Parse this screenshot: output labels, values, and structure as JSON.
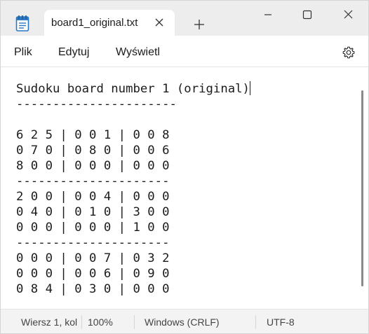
{
  "tab": {
    "title": "board1_original.txt",
    "app_icon": "notepad-icon",
    "close_icon": "close-icon",
    "new_tab_icon": "plus-icon"
  },
  "window_controls": {
    "minimize_icon": "minimize-icon",
    "maximize_icon": "maximize-icon",
    "close_icon": "close-icon"
  },
  "menu": {
    "items": [
      "Plik",
      "Edytuj",
      "Wyświetl"
    ],
    "settings_icon": "gear-icon"
  },
  "editor": {
    "lines": [
      "Sudoku board number 1 (original)",
      "----------------------",
      "",
      "6 2 5 | 0 0 1 | 0 0 8",
      "0 7 0 | 0 8 0 | 0 0 6",
      "8 0 0 | 0 0 0 | 0 0 0",
      "---------------------",
      "2 0 0 | 0 0 4 | 0 0 0",
      "0 4 0 | 0 1 0 | 3 0 0",
      "0 0 0 | 0 0 0 | 1 0 0",
      "---------------------",
      "0 0 0 | 0 0 7 | 0 3 2",
      "0 0 0 | 0 0 6 | 0 9 0",
      "0 8 4 | 0 3 0 | 0 0 0"
    ]
  },
  "status": {
    "position": "Wiersz 1, kol",
    "zoom": "100%",
    "line_ending": "Windows (CRLF)",
    "encoding": "UTF-8"
  }
}
